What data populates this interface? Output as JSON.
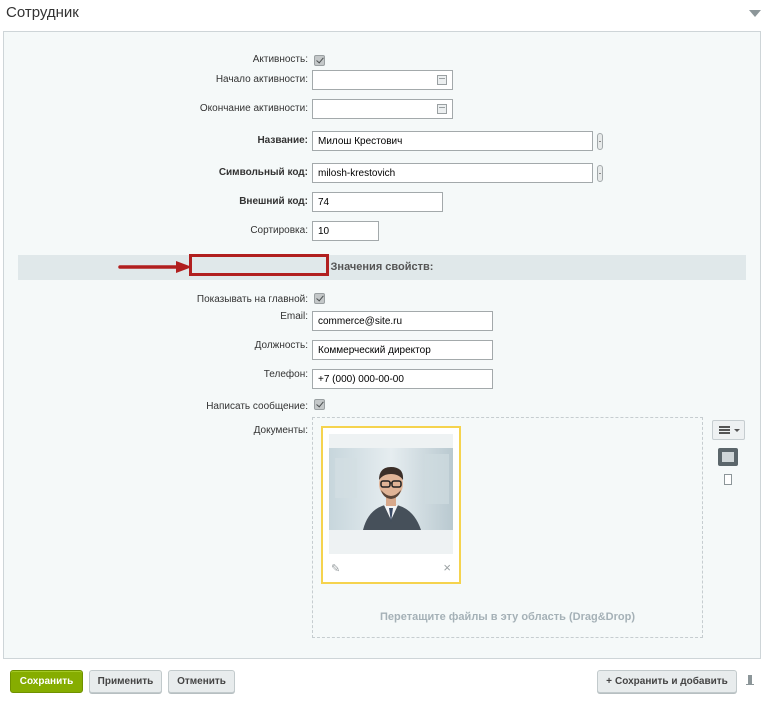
{
  "header": {
    "title": "Сотрудник"
  },
  "form": {
    "active_label": "Активность:",
    "active_start_label": "Начало активности:",
    "active_start_value": "",
    "active_end_label": "Окончание активности:",
    "active_end_value": "",
    "name_label": "Название:",
    "name_value": "Милош Крестович",
    "code_label": "Символьный код:",
    "code_value": "milosh-krestovich",
    "xml_id_label": "Внешний код:",
    "xml_id_value": "74",
    "sort_label": "Сортировка:",
    "sort_value": "10"
  },
  "properties": {
    "section_title": "Значения свойств:",
    "show_main_label": "Показывать на главной:",
    "email_label": "Email:",
    "email_value": "commerce@site.ru",
    "position_label": "Должность:",
    "position_value": "Коммерческий директор",
    "phone_label": "Телефон:",
    "phone_value": "+7 (000) 000-00-00",
    "write_msg_label": "Написать сообщение:",
    "documents_label": "Документы:",
    "dropzone_hint": "Перетащите файлы в эту область (Drag&Drop)"
  },
  "buttons": {
    "save": "Сохранить",
    "apply": "Применить",
    "cancel": "Отменить",
    "save_add": "Сохранить и добавить"
  },
  "colors": {
    "accent_green": "#86ad00",
    "highlight_red": "#b11f1f",
    "card_border": "#f5d34e"
  }
}
